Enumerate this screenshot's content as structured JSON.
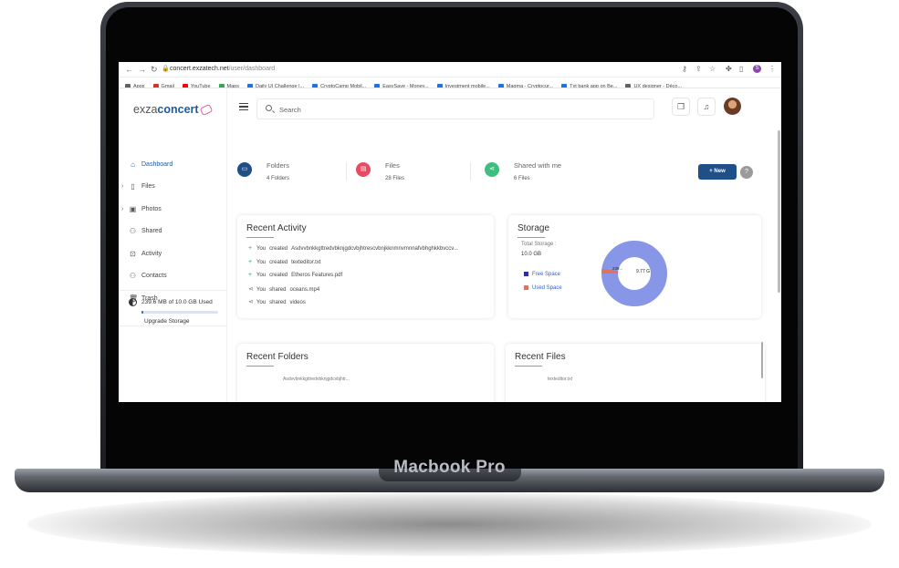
{
  "device": {
    "model_label": "Macbook Pro"
  },
  "browser": {
    "url_host": "concert.exzatech.net",
    "url_path": "/user/dashboard",
    "bookmarks": [
      {
        "label": "Apps",
        "color": "#5f6368"
      },
      {
        "label": "Gmail",
        "color": "#d93025"
      },
      {
        "label": "YouTube",
        "color": "#ff0000"
      },
      {
        "label": "Maps",
        "color": "#34a853"
      },
      {
        "label": "Daily UI Challenge |...",
        "color": "#1a73e8"
      },
      {
        "label": "CryptoCamp Mobil...",
        "color": "#1a73e8"
      },
      {
        "label": "EasySave - Money...",
        "color": "#1a73e8"
      },
      {
        "label": "Investment mobile...",
        "color": "#1a73e8"
      },
      {
        "label": "Magma - Cryptocur...",
        "color": "#1a73e8"
      },
      {
        "label": "Txt bank app on Be...",
        "color": "#1a73e8"
      },
      {
        "label": "UX designer - Déco...",
        "color": "#5f6368"
      }
    ],
    "profile_initial": "S"
  },
  "app": {
    "logo_prefix": "exza",
    "logo_bold": "concert",
    "nav": [
      {
        "label": "Dashboard",
        "icon": "home-icon",
        "glyph": "⌂",
        "active": true,
        "caret": false
      },
      {
        "label": "Files",
        "icon": "file-icon",
        "glyph": "▯",
        "active": false,
        "caret": true
      },
      {
        "label": "Photos",
        "icon": "image-icon",
        "glyph": "▣",
        "active": false,
        "caret": true
      },
      {
        "label": "Shared",
        "icon": "people-icon",
        "glyph": "⚇",
        "active": false,
        "caret": false
      },
      {
        "label": "Activity",
        "icon": "activity-icon",
        "glyph": "⊡",
        "active": false,
        "caret": false
      },
      {
        "label": "Contacts",
        "icon": "contacts-icon",
        "glyph": "⚇",
        "active": false,
        "caret": false
      },
      {
        "label": "Trash",
        "icon": "trash-icon",
        "glyph": "🗑",
        "active": false,
        "caret": false
      }
    ],
    "storage_used_text": "239.6 MB of 10.0 GB Used",
    "storage_fraction": 0.0234,
    "upgrade_label": "Upgrade Storage",
    "search_placeholder": "Search",
    "stats": [
      {
        "title": "Folders",
        "count": "4 Folders",
        "icon": "folder-icon",
        "color": "#1e4f86",
        "glyph": "▭"
      },
      {
        "title": "Files",
        "count": "28 Files",
        "icon": "file-icon",
        "color": "#e84a5f",
        "glyph": "▤"
      },
      {
        "title": "Shared with me",
        "count": "6 Files",
        "icon": "share-icon",
        "color": "#3fbf7f",
        "glyph": "⋖"
      }
    ],
    "new_button_label": "New",
    "help_label": "?",
    "recent_activity": {
      "title": "Recent Activity",
      "items": [
        {
          "type": "create",
          "user": "You",
          "action": "created",
          "target": "Asdvvbnkkgttredvbknjgdcvbjhtrescvbnjkknmnvmnnafvbhghkkbvccv..."
        },
        {
          "type": "create",
          "user": "You",
          "action": "created",
          "target": "texteditor.txt"
        },
        {
          "type": "create",
          "user": "You",
          "action": "created",
          "target": "Etheros Features.pdf"
        },
        {
          "type": "share",
          "user": "You",
          "action": "shared",
          "target": "oceans.mp4"
        },
        {
          "type": "share",
          "user": "You",
          "action": "shared",
          "target": "videos"
        }
      ]
    },
    "storage_card": {
      "title": "Storage",
      "total_label": "Total Storage :",
      "total_value": "10.0 GB",
      "legend": [
        {
          "label": "Free Space",
          "color": "#2b2f9a"
        },
        {
          "label": "Used Space",
          "color": "#e2725b"
        }
      ],
      "used_label": "239...",
      "free_label": "9.77 G",
      "used_fraction": 0.0234,
      "colors": {
        "free": "#8796e6",
        "used": "#e2725b"
      }
    },
    "recent_folders": {
      "title": "Recent Folders",
      "peek": "Asdvvbnkkgttredvbknjgdcvbjhtr..."
    },
    "recent_files": {
      "title": "Recent Files",
      "peek": "texteditor.txt"
    }
  }
}
